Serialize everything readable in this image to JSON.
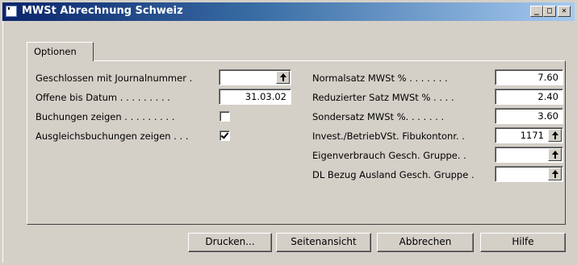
{
  "window": {
    "title": "MWSt Abrechnung Schweiz",
    "minimize_glyph": "_",
    "maximize_glyph": "□",
    "close_glyph": "✕"
  },
  "tabs": [
    {
      "label": "Optionen",
      "selected": true
    }
  ],
  "left_fields": {
    "journal": {
      "label": "Geschlossen mit Journalnummer  .",
      "value": ""
    },
    "offene": {
      "label": "Offene bis Datum  . . . . . . . . .",
      "value": "31.03.02"
    },
    "buchungen": {
      "label": "Buchungen zeigen . . . . . . . . .",
      "checked": false
    },
    "ausgleich": {
      "label": "Ausgleichsbuchungen zeigen . . .",
      "checked": true
    }
  },
  "right_fields": {
    "normalsatz": {
      "label": "Normalsatz MWSt % . . . . . . .",
      "value": "7.60"
    },
    "reduziert": {
      "label": "Reduzierter Satz MWSt % . . . .",
      "value": "2.40"
    },
    "sondersatz": {
      "label": "Sondersatz MWSt %. . . . . . .",
      "value": "3.60"
    },
    "invest": {
      "label": "Invest./BetriebVSt. Fibukontonr. .",
      "value": "1171"
    },
    "eigenverbrauch": {
      "label": "Eigenverbrauch Gesch. Gruppe. .",
      "value": ""
    },
    "dlbezug": {
      "label": "DL Bezug Ausland Gesch. Gruppe .",
      "value": ""
    }
  },
  "buttons": {
    "drucken": "Drucken...",
    "seitenansicht": "Seitenansicht",
    "abbrechen": "Abbrechen",
    "hilfe": "Hilfe"
  },
  "colors": {
    "titlebar_start": "#0a246a",
    "titlebar_end": "#a6caf0",
    "face": "#d4d0c8"
  }
}
